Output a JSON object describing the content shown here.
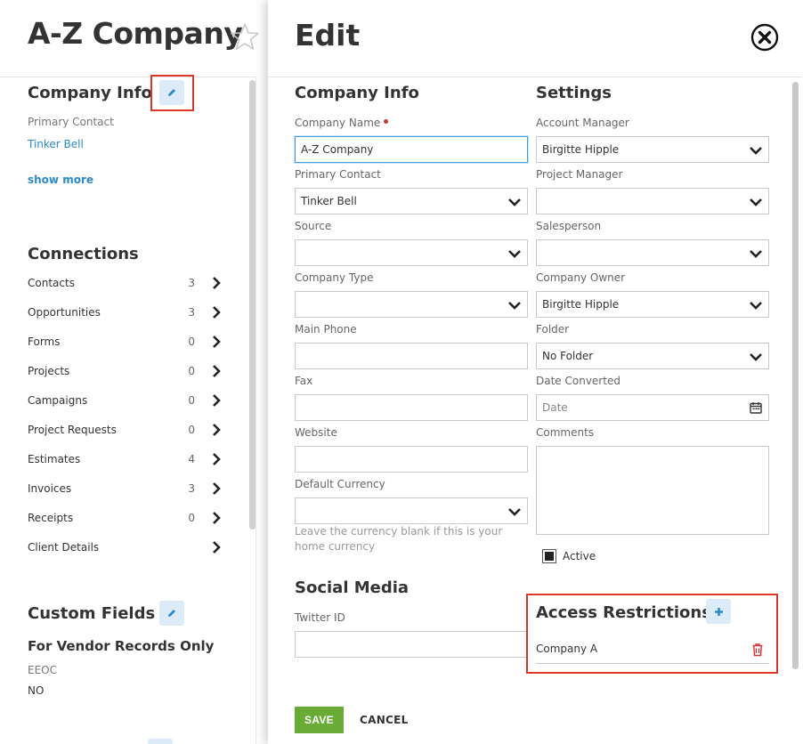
{
  "colors": {
    "accent": "#2a8bc9",
    "save_green": "#6aab35",
    "highlight_red": "#d9372a",
    "required_dot": "#c0392b",
    "pill_bg": "#dcebf7"
  },
  "left": {
    "title": "A-Z Company",
    "company_info": {
      "heading": "Company Info",
      "primary_contact_label": "Primary Contact",
      "primary_contact_value": "Tinker Bell",
      "show_more": "show more"
    },
    "connections": {
      "heading": "Connections",
      "items": [
        {
          "label": "Contacts",
          "count": "3"
        },
        {
          "label": "Opportunities",
          "count": "3"
        },
        {
          "label": "Forms",
          "count": "0"
        },
        {
          "label": "Projects",
          "count": "0"
        },
        {
          "label": "Campaigns",
          "count": "0"
        },
        {
          "label": "Project Requests",
          "count": "0"
        },
        {
          "label": "Estimates",
          "count": "4"
        },
        {
          "label": "Invoices",
          "count": "3"
        },
        {
          "label": "Receipts",
          "count": "0"
        },
        {
          "label": "Client Details",
          "count": ""
        }
      ]
    },
    "custom_fields": {
      "heading": "Custom Fields",
      "group": "For Vendor Records Only",
      "field_label": "EEOC",
      "field_value": "NO"
    }
  },
  "modal": {
    "title": "Edit",
    "company_info": {
      "heading": "Company Info",
      "company_name": {
        "label": "Company Name",
        "value": "A-Z Company"
      },
      "primary_contact": {
        "label": "Primary Contact",
        "value": "Tinker Bell"
      },
      "source": {
        "label": "Source",
        "value": ""
      },
      "company_type": {
        "label": "Company Type",
        "value": ""
      },
      "main_phone": {
        "label": "Main Phone",
        "value": ""
      },
      "fax": {
        "label": "Fax",
        "value": ""
      },
      "website": {
        "label": "Website",
        "value": ""
      },
      "default_currency": {
        "label": "Default Currency",
        "value": "",
        "help": "Leave the currency blank if this is your home currency"
      }
    },
    "settings": {
      "heading": "Settings",
      "account_manager": {
        "label": "Account Manager",
        "value": "Birgitte Hipple"
      },
      "project_manager": {
        "label": "Project Manager",
        "value": ""
      },
      "salesperson": {
        "label": "Salesperson",
        "value": ""
      },
      "company_owner": {
        "label": "Company Owner",
        "value": "Birgitte Hipple"
      },
      "folder": {
        "label": "Folder",
        "value": "No Folder"
      },
      "date_converted": {
        "label": "Date Converted",
        "placeholder": "Date"
      },
      "comments": {
        "label": "Comments",
        "value": ""
      },
      "active": {
        "label": "Active",
        "checked": true
      }
    },
    "social_media": {
      "heading": "Social Media",
      "twitter": {
        "label": "Twitter ID",
        "value": ""
      }
    },
    "access_restrictions": {
      "heading": "Access Restrictions",
      "items": [
        "Company A"
      ]
    },
    "save_label": "SAVE",
    "cancel_label": "CANCEL"
  }
}
